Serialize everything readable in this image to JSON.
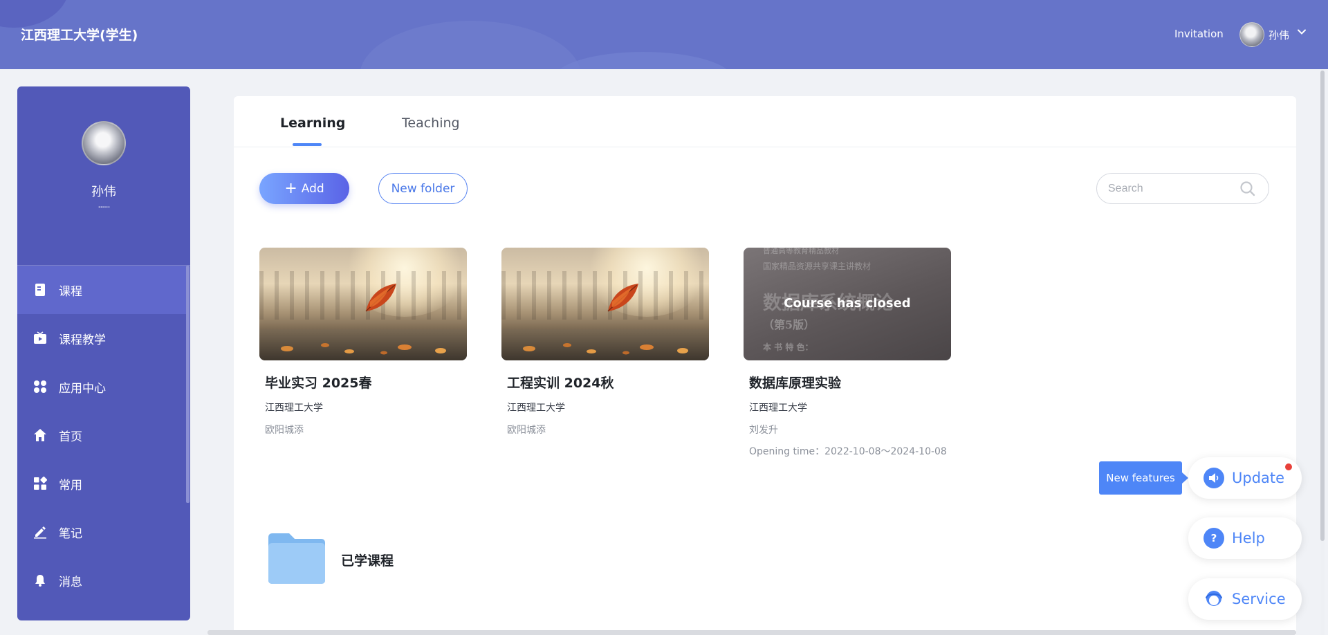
{
  "header": {
    "title": "江西理工大学(学生)",
    "invitation": "Invitation",
    "user_name": "孙伟",
    "avatar_icon": "user-avatar",
    "caret_icon": "chevron-down-icon"
  },
  "sidebar": {
    "user_name": "孙伟",
    "user_sub": "......",
    "items": [
      {
        "label": "课程",
        "icon": "book-icon",
        "active": true
      },
      {
        "label": "课程教学",
        "icon": "video-play-icon",
        "active": false
      },
      {
        "label": "应用中心",
        "icon": "apps-icon",
        "active": false
      },
      {
        "label": "首页",
        "icon": "home-icon",
        "active": false
      },
      {
        "label": "常用",
        "icon": "grid-plus-icon",
        "active": false
      },
      {
        "label": "笔记",
        "icon": "edit-note-icon",
        "active": false
      },
      {
        "label": "消息",
        "icon": "bell-icon",
        "active": false
      }
    ]
  },
  "tabs": [
    {
      "label": "Learning",
      "active": true
    },
    {
      "label": "Teaching",
      "active": false
    }
  ],
  "toolbar": {
    "add_label": "Add",
    "new_folder_label": "New folder",
    "search_placeholder": "Search",
    "search_value": ""
  },
  "courses": [
    {
      "title": "毕业实习 2025春",
      "school": "江西理工大学",
      "teacher": "欧阳城添",
      "closed": false,
      "cover": "autumn-leaf"
    },
    {
      "title": "工程实训 2024秋",
      "school": "江西理工大学",
      "teacher": "欧阳城添",
      "closed": false,
      "cover": "autumn-leaf"
    },
    {
      "title": "数据库原理实验",
      "school": "江西理工大学",
      "teacher": "刘发升",
      "closed": true,
      "closed_label": "Course has closed",
      "opening_time": "Opening time：2022-10-08～2024-10-08",
      "cover": "textbook",
      "cover_text": {
        "line1": "普通高等教育精品教材",
        "line2": "国家精品资源共享课主讲教材",
        "line3": "数据库系统概论",
        "line4": "（第5版）",
        "line5": "本 书 特 色："
      }
    }
  ],
  "folders": [
    {
      "label": "已学课程",
      "icon": "folder-icon"
    }
  ],
  "widgets": {
    "new_features": "New features",
    "update": "Update",
    "help": "Help",
    "service": "Service"
  },
  "colors": {
    "header_bg": "#6674c9",
    "sidebar_bg": "#5259b8",
    "sidebar_active": "#6068cc",
    "accent": "#4e86f7",
    "badge_red": "#e8403a"
  }
}
